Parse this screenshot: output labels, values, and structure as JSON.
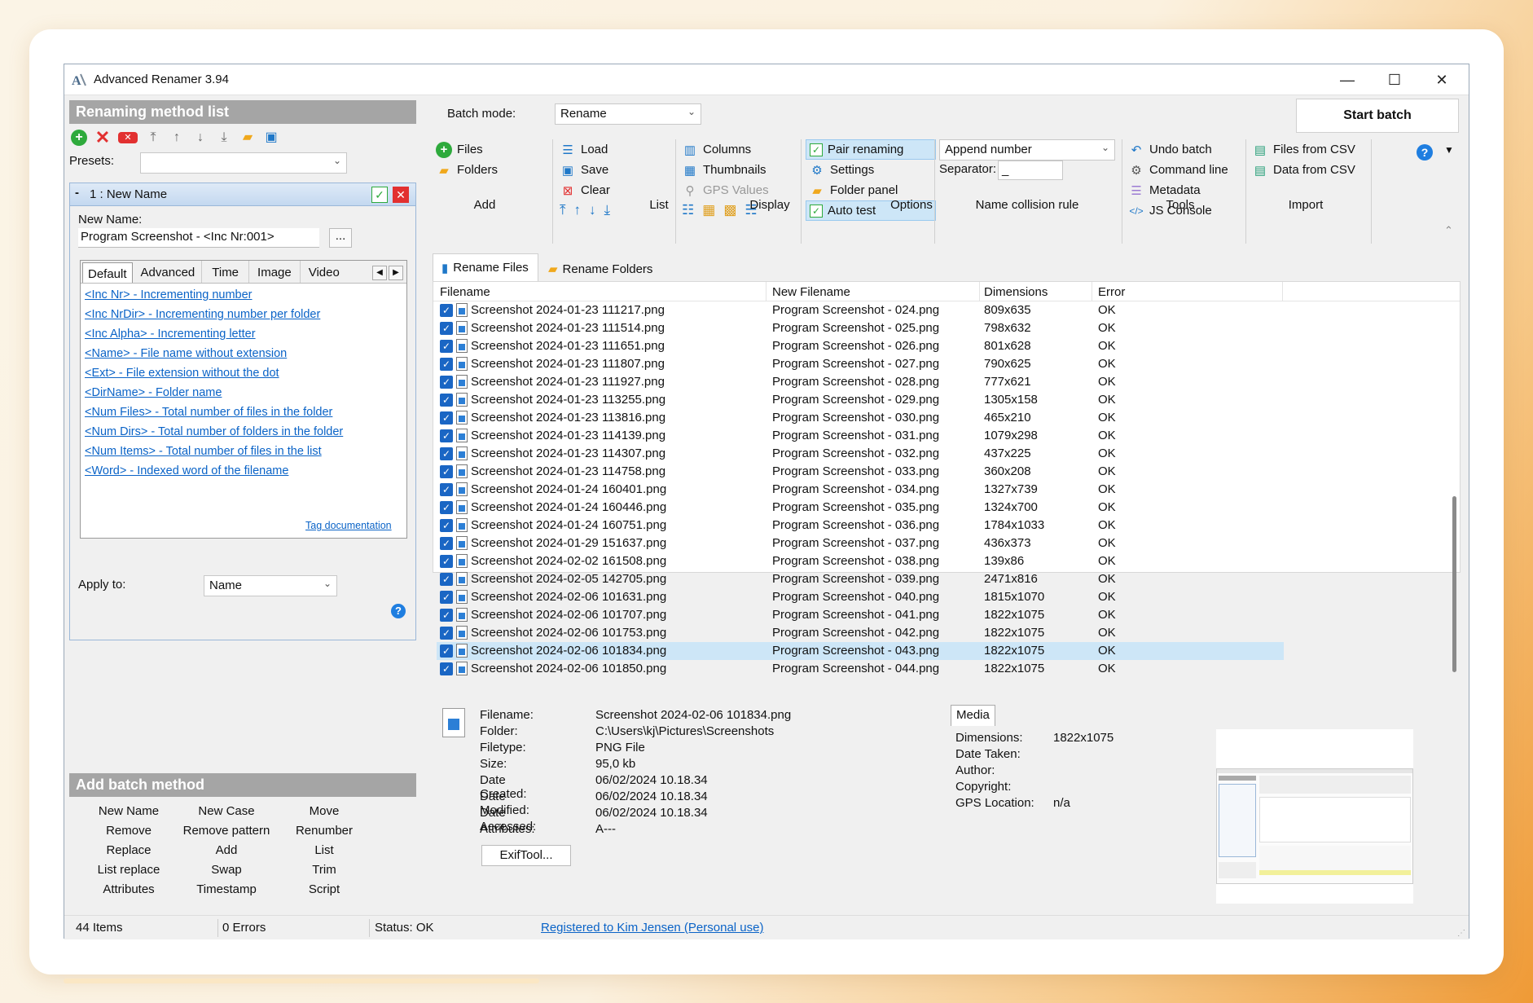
{
  "window": {
    "title": "Advanced Renamer 3.94",
    "minimize": "—",
    "maximize": "☐",
    "close": "✕"
  },
  "left": {
    "header": "Renaming method list",
    "presets_label": "Presets:",
    "method": {
      "title": "1 : New Name",
      "new_name_label": "New Name:",
      "new_name_value": "Program Screenshot - <Inc Nr:001>",
      "ellipsis": "...",
      "tabs": [
        "Default",
        "Advanced",
        "Time",
        "Image",
        "Video"
      ],
      "tags": [
        "<Inc Nr> - Incrementing number",
        "<Inc NrDir> - Incrementing number per folder",
        "<Inc Alpha> - Incrementing letter",
        "<Name> - File name without extension",
        "<Ext> - File extension without the dot",
        "<DirName> - Folder name",
        "<Num Files> - Total number of files in the folder",
        "<Num Dirs> - Total number of folders in the folder",
        "<Num Items> - Total number of files in the list",
        "<Word> - Indexed word of the filename"
      ],
      "tag_doc": "Tag documentation",
      "apply_to_label": "Apply to:",
      "apply_to_value": "Name"
    },
    "batch_header": "Add batch method",
    "batch_methods": [
      [
        "New Name",
        "New Case",
        "Move"
      ],
      [
        "Remove",
        "Remove pattern",
        "Renumber"
      ],
      [
        "Replace",
        "Add",
        "List"
      ],
      [
        "List replace",
        "Swap",
        "Trim"
      ],
      [
        "Attributes",
        "Timestamp",
        "Script"
      ]
    ]
  },
  "ribbon": {
    "batch_mode_label": "Batch mode:",
    "batch_mode_value": "Rename",
    "start_batch": "Start batch",
    "add": {
      "label": "Add",
      "files": "Files",
      "folders": "Folders"
    },
    "list": {
      "label": "List",
      "load": "Load",
      "save": "Save",
      "clear": "Clear"
    },
    "display": {
      "label": "Display",
      "columns": "Columns",
      "thumbnails": "Thumbnails",
      "gps": "GPS Values"
    },
    "options": {
      "label": "Options",
      "pair": "Pair renaming",
      "settings": "Settings",
      "folder_panel": "Folder panel",
      "auto_test": "Auto test"
    },
    "collision": {
      "label": "Name collision rule",
      "value": "Append number",
      "separator_label": "Separator:",
      "separator_value": "_"
    },
    "tools": {
      "label": "Tools",
      "undo": "Undo batch",
      "cmd": "Command line",
      "meta": "Metadata",
      "js": "JS Console"
    },
    "import": {
      "label": "Import",
      "from_csv": "Files from CSV",
      "data_csv": "Data from CSV"
    }
  },
  "tabs": {
    "rename_files": "Rename Files",
    "rename_folders": "Rename Folders"
  },
  "table": {
    "columns": [
      "Filename",
      "New Filename",
      "Dimensions",
      "Error"
    ],
    "rows": [
      [
        "Screenshot 2024-01-23 111217.png",
        "Program Screenshot - 024.png",
        "809x635",
        "OK"
      ],
      [
        "Screenshot 2024-01-23 111514.png",
        "Program Screenshot - 025.png",
        "798x632",
        "OK"
      ],
      [
        "Screenshot 2024-01-23 111651.png",
        "Program Screenshot - 026.png",
        "801x628",
        "OK"
      ],
      [
        "Screenshot 2024-01-23 111807.png",
        "Program Screenshot - 027.png",
        "790x625",
        "OK"
      ],
      [
        "Screenshot 2024-01-23 111927.png",
        "Program Screenshot - 028.png",
        "777x621",
        "OK"
      ],
      [
        "Screenshot 2024-01-23 113255.png",
        "Program Screenshot - 029.png",
        "1305x158",
        "OK"
      ],
      [
        "Screenshot 2024-01-23 113816.png",
        "Program Screenshot - 030.png",
        "465x210",
        "OK"
      ],
      [
        "Screenshot 2024-01-23 114139.png",
        "Program Screenshot - 031.png",
        "1079x298",
        "OK"
      ],
      [
        "Screenshot 2024-01-23 114307.png",
        "Program Screenshot - 032.png",
        "437x225",
        "OK"
      ],
      [
        "Screenshot 2024-01-23 114758.png",
        "Program Screenshot - 033.png",
        "360x208",
        "OK"
      ],
      [
        "Screenshot 2024-01-24 160401.png",
        "Program Screenshot - 034.png",
        "1327x739",
        "OK"
      ],
      [
        "Screenshot 2024-01-24 160446.png",
        "Program Screenshot - 035.png",
        "1324x700",
        "OK"
      ],
      [
        "Screenshot 2024-01-24 160751.png",
        "Program Screenshot - 036.png",
        "1784x1033",
        "OK"
      ],
      [
        "Screenshot 2024-01-29 151637.png",
        "Program Screenshot - 037.png",
        "436x373",
        "OK"
      ],
      [
        "Screenshot 2024-02-02 161508.png",
        "Program Screenshot - 038.png",
        "139x86",
        "OK"
      ],
      [
        "Screenshot 2024-02-05 142705.png",
        "Program Screenshot - 039.png",
        "2471x816",
        "OK"
      ],
      [
        "Screenshot 2024-02-06 101631.png",
        "Program Screenshot - 040.png",
        "1815x1070",
        "OK"
      ],
      [
        "Screenshot 2024-02-06 101707.png",
        "Program Screenshot - 041.png",
        "1822x1075",
        "OK"
      ],
      [
        "Screenshot 2024-02-06 101753.png",
        "Program Screenshot - 042.png",
        "1822x1075",
        "OK"
      ],
      [
        "Screenshot 2024-02-06 101834.png",
        "Program Screenshot - 043.png",
        "1822x1075",
        "OK"
      ],
      [
        "Screenshot 2024-02-06 101850.png",
        "Program Screenshot - 044.png",
        "1822x1075",
        "OK"
      ]
    ],
    "selected_row": 19
  },
  "details": {
    "labels": [
      "Filename:",
      "Folder:",
      "Filetype:",
      "Size:",
      "Date Created:",
      "Date Modified:",
      "Date Accessed:",
      "Attributes:"
    ],
    "values": [
      "Screenshot 2024-02-06 101834.png",
      "C:\\Users\\kj\\Pictures\\Screenshots",
      "PNG File",
      "95,0 kb",
      "06/02/2024 10.18.34",
      "06/02/2024 10.18.34",
      "06/02/2024 10.18.34",
      "A---"
    ],
    "exif_button": "ExifTool...",
    "media_tab": "Media",
    "media_labels": [
      "Dimensions:",
      "Date Taken:",
      "Author:",
      "Copyright:",
      "GPS Location:"
    ],
    "media_values": [
      "1822x1075",
      "",
      "",
      "",
      "n/a"
    ]
  },
  "status": {
    "items": "44 Items",
    "errors": "0 Errors",
    "status": "Status: OK",
    "registered": "Registered to Kim Jensen (Personal use)"
  },
  "colors": {
    "accent": "#1a66c4",
    "selected": "#cde6f7",
    "link": "#0a63c7",
    "header_gray": "#a5a5a5"
  }
}
